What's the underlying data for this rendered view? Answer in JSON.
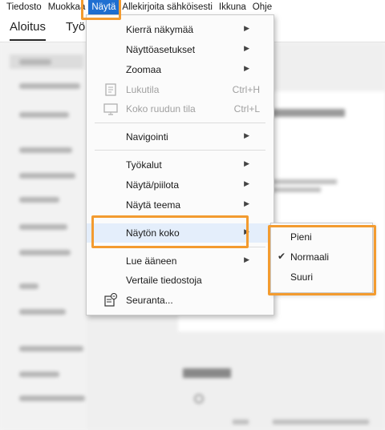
{
  "menubar": {
    "items": [
      "Tiedosto",
      "Muokkaa",
      "Näytä",
      "Allekirjoita sähköisesti",
      "Ikkuna",
      "Ohje"
    ],
    "active_index": 2
  },
  "tabs": [
    "Aloitus",
    "Työ"
  ],
  "view_menu": {
    "rotate": "Kierrä näkymää",
    "display_settings": "Näyttöasetukset",
    "zoom": "Zoomaa",
    "read_mode": "Lukutila",
    "read_mode_shortcut": "Ctrl+H",
    "fullscreen": "Koko ruudun tila",
    "fullscreen_shortcut": "Ctrl+L",
    "navigation": "Navigointi",
    "tools": "Työkalut",
    "show_hide": "Näytä/piilota",
    "show_theme": "Näytä teema",
    "screen_size": "Näytön koko",
    "read_aloud": "Lue ääneen",
    "compare": "Vertaile tiedostoja",
    "tracking": "Seuranta..."
  },
  "size_submenu": {
    "small": "Pieni",
    "normal": "Normaali",
    "large": "Suuri",
    "selected": "Normaali"
  },
  "colors": {
    "highlight": "#f39b2f",
    "menubar_active": "#1f6fd1"
  }
}
